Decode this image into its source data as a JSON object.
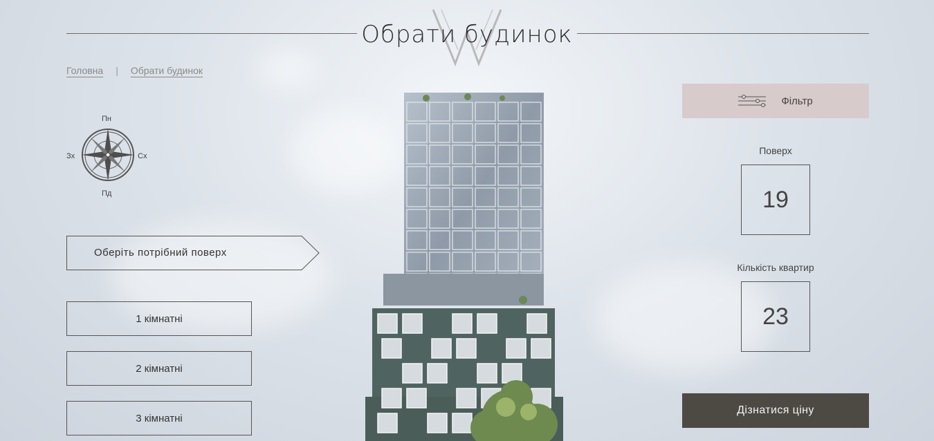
{
  "header": {
    "title": "Обрати будинок"
  },
  "breadcrumb": {
    "home": "Головна",
    "current": "Обрати будинок"
  },
  "compass": {
    "north": "Пн",
    "south": "Пд",
    "west": "Зх",
    "east": "Сх"
  },
  "floor_select": {
    "label": "Оберіть потрібний поверх"
  },
  "rooms": [
    {
      "label": "1 кімнатні"
    },
    {
      "label": "2 кімнатні"
    },
    {
      "label": "3 кімнатні"
    }
  ],
  "filter": {
    "label": "Фільтр",
    "icon": "sliders-icon"
  },
  "stats": {
    "floor_label": "Поверх",
    "floor_value": "19",
    "apartments_label": "Кількість квартир",
    "apartments_value": "23"
  },
  "price_button": {
    "label": "Дізнатися ціну"
  },
  "colors": {
    "filter_bg": "#d8cbcb",
    "price_bg": "#4d4a44",
    "building": "#4f6460"
  }
}
